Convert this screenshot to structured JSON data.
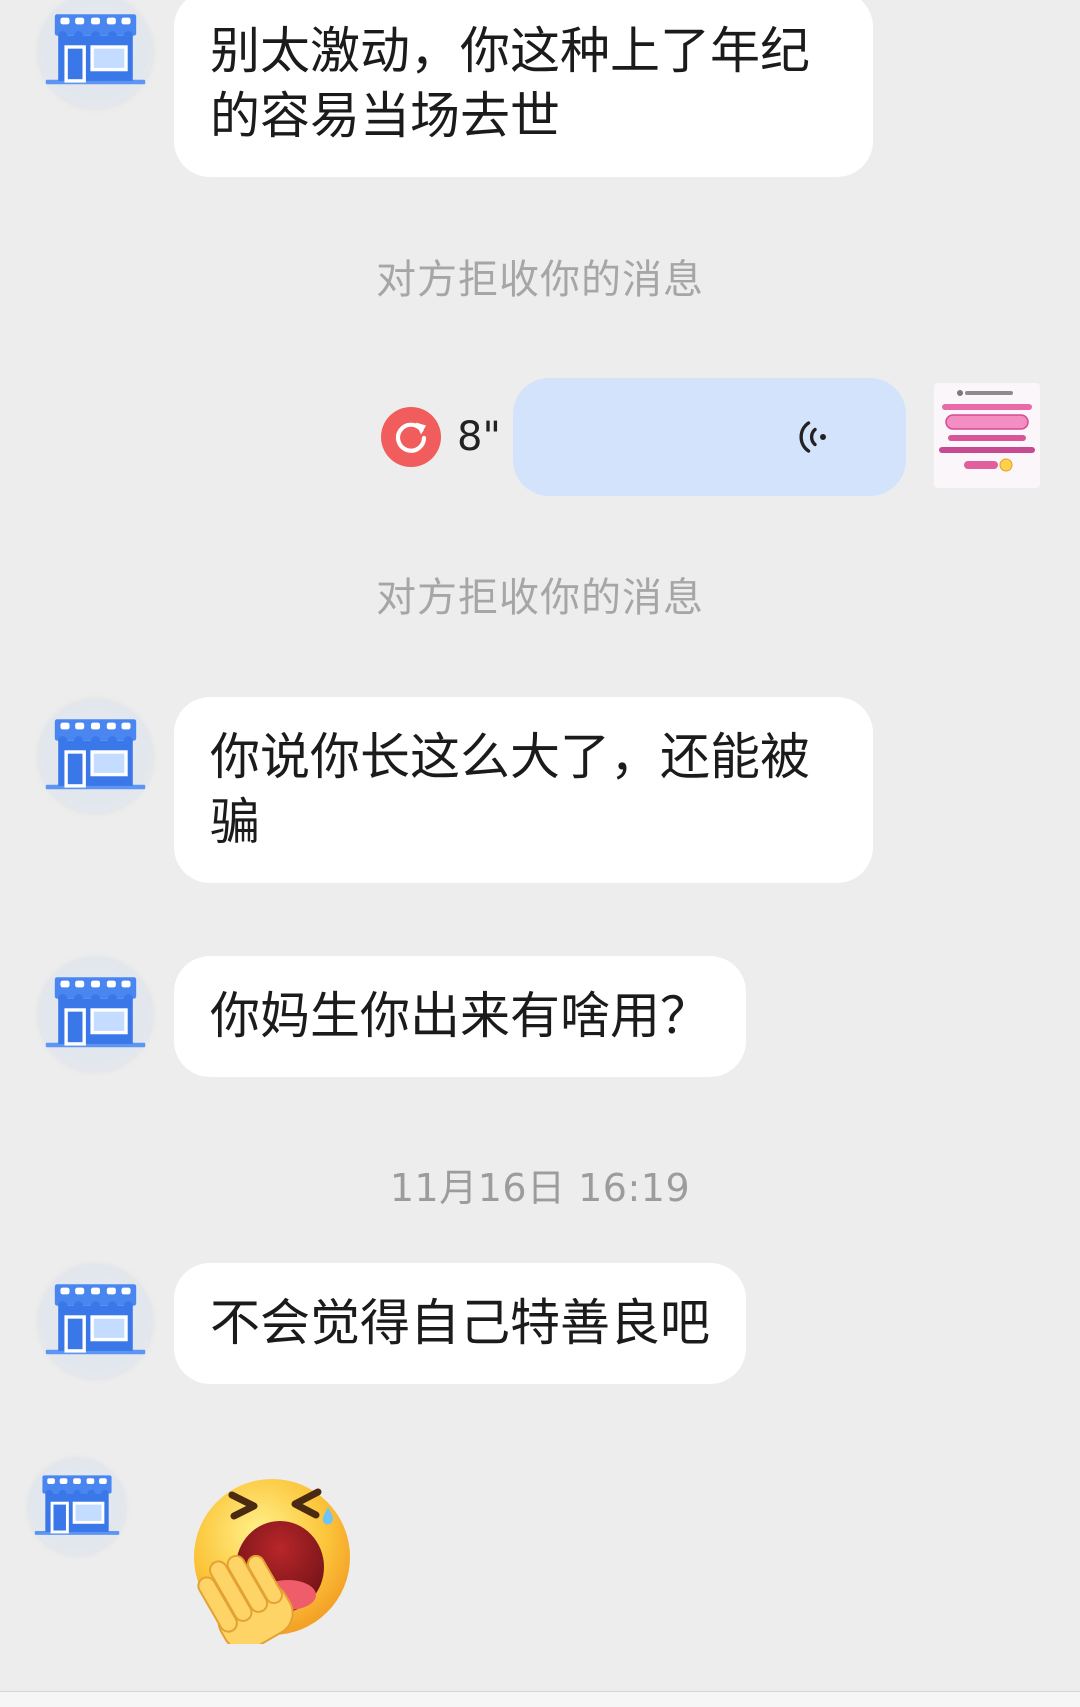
{
  "colors": {
    "background": "#ededed",
    "bubble_received": "#ffffff",
    "bubble_voice_sent": "#d3e3fb",
    "message_text": "#1b1b1b",
    "system_text": "#a6a6a6",
    "resend_red": "#f15c5c",
    "shop_icon_blue": "#3a77e9"
  },
  "icons": {
    "contact_avatar": "shop-icon",
    "self_avatar": "pink-text-avatar-image",
    "resend": "retry-icon",
    "voice": "voice-wave-icon"
  },
  "messages": [
    {
      "incoming_text": "别太激动，你这种上了年纪的容易当场去世"
    },
    {
      "system_notice": "对方拒收你的消息"
    },
    {
      "outgoing_voice_duration": "8\""
    },
    {
      "system_notice": "对方拒收你的消息"
    },
    {
      "incoming_text": "你说你长这么大了，还能被骗"
    },
    {
      "incoming_text": "你妈生你出来有啥用？"
    },
    {
      "timestamp": "11月16日 16:19"
    },
    {
      "incoming_text": "不会觉得自己特善良吧"
    },
    {
      "incoming_sticker": "yawning-face-emoji"
    }
  ]
}
